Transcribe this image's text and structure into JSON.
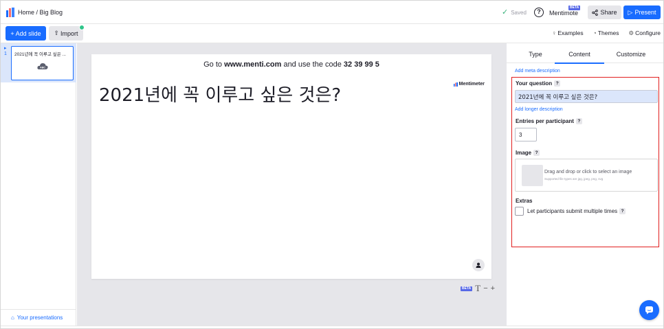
{
  "header": {
    "breadcrumb": "Home / Big Blog",
    "saved_label": "Saved",
    "help_label": "?",
    "mentimote_label": "Mentimote",
    "mentimote_badge": "BETA",
    "share_label": "Share",
    "present_label": "Present"
  },
  "toolbar": {
    "add_slide_label": "+ Add slide",
    "import_label": "Import",
    "examples_label": "Examples",
    "themes_label": "Themes",
    "configure_label": "Configure"
  },
  "sidebar": {
    "slides": [
      {
        "number": "1",
        "title": "2021년에 꼭 이루고 싶은 ..."
      }
    ],
    "your_presentations_label": "Your presentations"
  },
  "slide": {
    "join_prefix": "Go to ",
    "join_url": "www.menti.com",
    "join_middle": " and use the code ",
    "join_code": "32 39 99 5",
    "question": "2021년에 꼭 이루고 싶은 것은?",
    "brand": "Mentimeter"
  },
  "canvas_tools": {
    "beta_badge": "BETA",
    "text_icon": "T",
    "zoom_out": "−",
    "zoom_in": "+"
  },
  "panel": {
    "tabs": [
      {
        "label": "Type",
        "active": false
      },
      {
        "label": "Content",
        "active": true
      },
      {
        "label": "Customize",
        "active": false
      }
    ],
    "add_meta_description": "Add meta description",
    "question_label": "Your question",
    "question_value": "2021년에 꼭 이루고 싶은 것은?",
    "add_longer_description": "Add longer description",
    "entries_label": "Entries per participant",
    "entries_value": "3",
    "image_label": "Image",
    "image_drop_text": "Drag and drop or click to select an image",
    "image_supported": "Supported file types are jpg, jpeg, png, svg",
    "extras_label": "Extras",
    "multiple_label": "Let participants submit multiple times",
    "help_mark": "?"
  },
  "colors": {
    "accent": "#196cff",
    "highlight_box": "#e11d1d",
    "saved_check": "#38b27a"
  }
}
